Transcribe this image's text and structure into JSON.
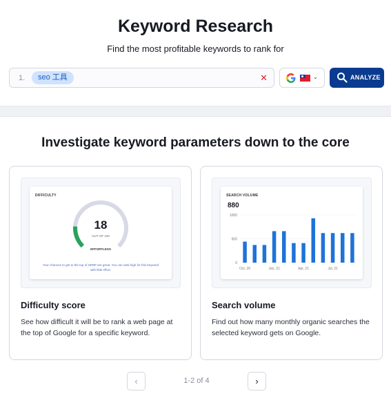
{
  "header": {
    "title": "Keyword Research",
    "subtitle": "Find the most profitable keywords to rank for"
  },
  "search": {
    "index": "1.",
    "keyword_chip": "seo 工具",
    "clear_icon": "close-icon",
    "clear_symbol": "✕",
    "engine_icon": "google-icon",
    "country_flag": "taiwan-flag-icon",
    "dropdown_icon": "chevron-down-icon",
    "dropdown_symbol": "⌄",
    "analyze_label": "ANALYZE",
    "analyze_color": "#0b3b91"
  },
  "section": {
    "title": "Investigate keyword parameters down to the core"
  },
  "cards": [
    {
      "preview": {
        "label": "DIFFICULTY",
        "value": "18",
        "value_sub": "OUT OF 100",
        "tag": "EFFORTLESS",
        "footnote": "Your chances to get to the top of SERP are great. You can rank high for this keyword with little effort."
      },
      "title": "Difficulty score",
      "description": "See how difficult it will be to rank a web page at the top of Google for a specific keyword."
    },
    {
      "preview": {
        "label": "SEARCH VOLUME",
        "value": "880"
      },
      "title": "Search volume",
      "description": "Find out how many monthly organic searches the selected keyword gets on Google."
    }
  ],
  "chart_data": {
    "type": "bar",
    "title": "SEARCH VOLUME",
    "x_tick_labels": [
      "Oct, 20",
      "Jan, 21",
      "Apr, 21",
      "Jul, 21"
    ],
    "x_tick_index": [
      0,
      3,
      6,
      9
    ],
    "values": [
      440,
      370,
      370,
      660,
      660,
      410,
      410,
      930,
      620,
      620,
      620,
      620
    ],
    "y_ticks": [
      0,
      500,
      1000
    ],
    "ylim": [
      0,
      1000
    ],
    "bar_color": "#1e73d8"
  },
  "gauge": {
    "value": 18,
    "max": 100,
    "fill_color": "#27a35a",
    "track_color": "#d7d9e6"
  },
  "pager": {
    "prev_symbol": "‹",
    "next_symbol": "›",
    "info": "1-2 of 4"
  }
}
